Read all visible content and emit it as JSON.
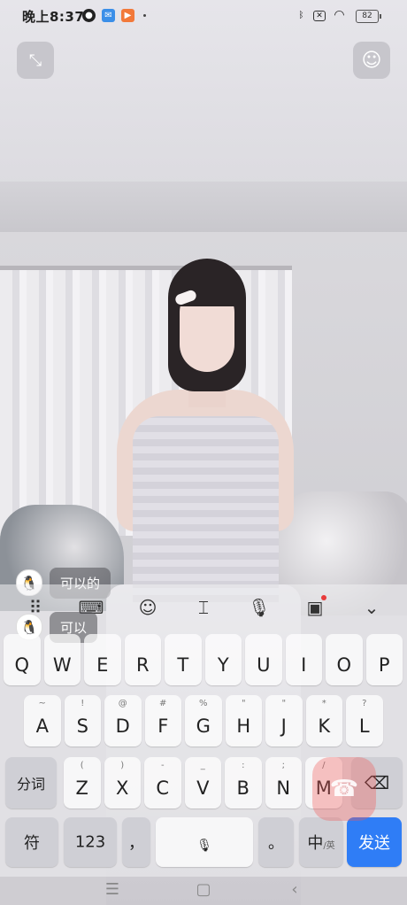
{
  "status_bar": {
    "time": "晚上8:37",
    "battery": "82",
    "icons": [
      "qq-icon",
      "mail-app-icon",
      "video-app-icon",
      "bluetooth-icon",
      "no-sim-icon",
      "wifi-icon",
      "battery-icon"
    ]
  },
  "call_controls": {
    "minimize_icon": "minimize-icon",
    "effects_icon": "beauty-face-icon"
  },
  "chat": {
    "messages": [
      {
        "text": "可以的"
      },
      {
        "text": "可以"
      }
    ]
  },
  "keyboard": {
    "toolbar": [
      "apps-grid-icon",
      "keyboard-icon",
      "emoji-icon",
      "cursor-icon",
      "mic-icon",
      "toolbox-icon",
      "collapse-icon"
    ],
    "row1": [
      {
        "main": "Q",
        "sub": ""
      },
      {
        "main": "W",
        "sub": ""
      },
      {
        "main": "E",
        "sub": ""
      },
      {
        "main": "R",
        "sub": ""
      },
      {
        "main": "T",
        "sub": ""
      },
      {
        "main": "Y",
        "sub": ""
      },
      {
        "main": "U",
        "sub": ""
      },
      {
        "main": "I",
        "sub": ""
      },
      {
        "main": "O",
        "sub": ""
      },
      {
        "main": "P",
        "sub": ""
      }
    ],
    "row2": [
      {
        "main": "A",
        "sub": "~"
      },
      {
        "main": "S",
        "sub": "!"
      },
      {
        "main": "D",
        "sub": "@"
      },
      {
        "main": "F",
        "sub": "#"
      },
      {
        "main": "G",
        "sub": "%"
      },
      {
        "main": "H",
        "sub": "\""
      },
      {
        "main": "J",
        "sub": "\""
      },
      {
        "main": "K",
        "sub": "*"
      },
      {
        "main": "L",
        "sub": "?"
      }
    ],
    "row3_left": "分词",
    "row3": [
      {
        "main": "Z",
        "sub": "("
      },
      {
        "main": "X",
        "sub": ")"
      },
      {
        "main": "C",
        "sub": "-"
      },
      {
        "main": "V",
        "sub": "_"
      },
      {
        "main": "B",
        "sub": ":"
      },
      {
        "main": "N",
        "sub": ";"
      },
      {
        "main": "M",
        "sub": "/"
      }
    ],
    "row4": {
      "symbol": "符",
      "numbers": "123",
      "comma": "，",
      "period": "。",
      "lang_main": "中",
      "lang_sub": "/英",
      "send": "发送"
    }
  },
  "navigation": [
    "menu-icon",
    "home-icon",
    "back-icon"
  ]
}
